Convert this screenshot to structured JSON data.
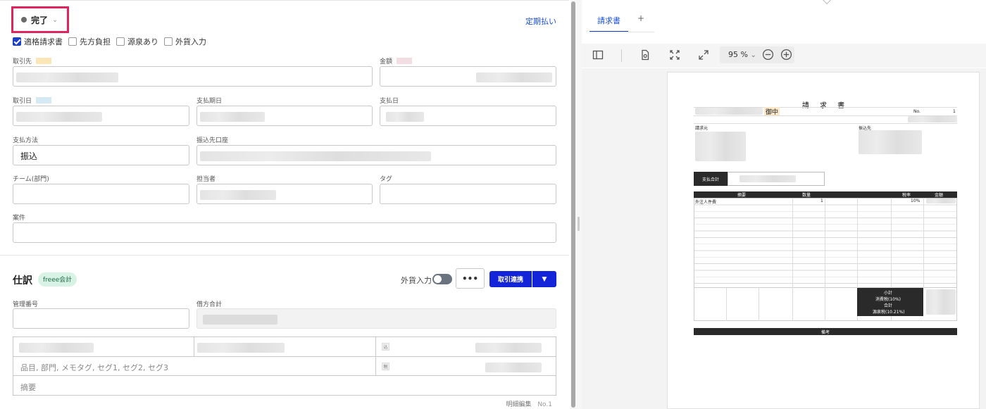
{
  "status": {
    "label": "完了"
  },
  "top_link": "定期払い",
  "options": [
    {
      "label": "適格請求書",
      "checked": true
    },
    {
      "label": "先方負担",
      "checked": false
    },
    {
      "label": "源泉あり",
      "checked": false
    },
    {
      "label": "外貨入力",
      "checked": false
    }
  ],
  "fields": {
    "partner_label": "取引先",
    "amount_label": "金額",
    "date_label": "取引日",
    "due_label": "支払期日",
    "paydate_label": "支払日",
    "method_label": "支払方法",
    "method_value": "振込",
    "account_label": "振込先口座",
    "team_label": "チーム(部門)",
    "owner_label": "担当者",
    "tag_label": "タグ",
    "project_label": "案件"
  },
  "journal": {
    "title": "仕訳",
    "badge": "freee会計",
    "fx_toggle_label": "外貨入力",
    "more_label": "•••",
    "primary_label": "取引連携",
    "mgmt_label": "管理番号",
    "debit_total_label": "借方合計",
    "tax_in_tag": "込",
    "tax_tag": "税",
    "items_placeholder": "品目, 部門, メモタグ, セグ1, セグ2, セグ3",
    "memo_placeholder": "摘要",
    "footer_left": "明細編集",
    "footer_right": "No.1"
  },
  "viewer": {
    "tab_label": "請求書",
    "tab_add": "+",
    "zoom": "95 %",
    "zoom_caret": "⌄"
  },
  "invoice": {
    "title": "請 求 書",
    "honorific": "御中",
    "no_label": "No.",
    "no_value": "1",
    "bill_from_label": "請求元",
    "bank_label": "振込先",
    "total_label": "支払合計",
    "col_desc": "摘要",
    "col_qty": "数量",
    "col_rate": "税率",
    "col_amount": "金額",
    "row1_desc": "外注人件費",
    "row1_qty": "1",
    "row1_rate": "10%",
    "subtotal_label": "小計",
    "tax_label": "消費税(10%)",
    "grand_total_label": "合計",
    "withholding_label": "源泉税(10.21%)",
    "remarks_label": "備考"
  },
  "colors": {
    "accent": "#1424d8",
    "highlight_box": "#e0245e",
    "partner_swatch": "#fbe6b8",
    "amount_swatch": "#f1dde2",
    "date_swatch": "#d5e9f3",
    "badge_bg": "#d9f2e6"
  }
}
